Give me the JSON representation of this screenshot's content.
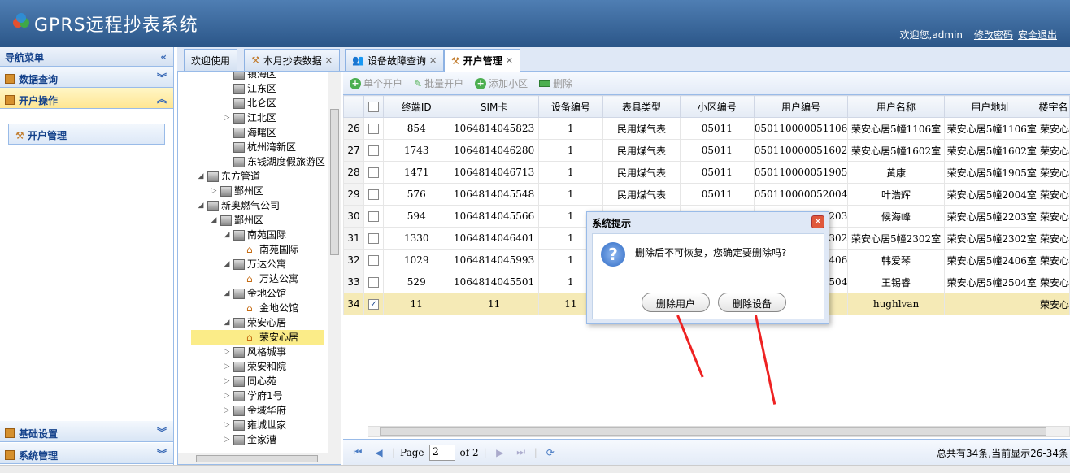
{
  "header": {
    "title": "GPRS远程抄表系统",
    "welcome": "欢迎您,admin",
    "change_password": "修改密码",
    "logout": "安全退出"
  },
  "nav": {
    "title": "导航菜单",
    "sections": [
      "数据查询",
      "开户操作",
      "基础设置",
      "系统管理"
    ],
    "active_item": "开户管理"
  },
  "tree": [
    {
      "label": "镇海区",
      "type": "building",
      "level": 2
    },
    {
      "label": "江东区",
      "type": "building",
      "level": 2
    },
    {
      "label": "北仑区",
      "type": "building",
      "level": 2
    },
    {
      "label": "江北区",
      "type": "building",
      "level": 2,
      "toggle": "▷"
    },
    {
      "label": "海曙区",
      "type": "building",
      "level": 2
    },
    {
      "label": "杭州湾新区",
      "type": "building",
      "level": 2
    },
    {
      "label": "东钱湖度假旅游区",
      "type": "building",
      "level": 2
    },
    {
      "label": "东方管道",
      "type": "building",
      "level": 0,
      "toggle": "◢"
    },
    {
      "label": "鄞州区",
      "type": "building",
      "level": 1,
      "toggle": "▷"
    },
    {
      "label": "新奥燃气公司",
      "type": "building",
      "level": 0,
      "toggle": "◢"
    },
    {
      "label": "鄞州区",
      "type": "building",
      "level": 1,
      "toggle": "◢"
    },
    {
      "label": "南苑国际",
      "type": "building",
      "level": 2,
      "toggle": "◢"
    },
    {
      "label": "南苑国际",
      "type": "house",
      "level": 3
    },
    {
      "label": "万达公寓",
      "type": "building",
      "level": 2,
      "toggle": "◢"
    },
    {
      "label": "万达公寓",
      "type": "house",
      "level": 3
    },
    {
      "label": "金地公馆",
      "type": "building",
      "level": 2,
      "toggle": "◢"
    },
    {
      "label": "金地公馆",
      "type": "house",
      "level": 3
    },
    {
      "label": "荣安心居",
      "type": "building",
      "level": 2,
      "toggle": "◢"
    },
    {
      "label": "荣安心居",
      "type": "house",
      "level": 3,
      "selected": true
    },
    {
      "label": "风格城事",
      "type": "building",
      "level": 2,
      "toggle": "▷"
    },
    {
      "label": "荣安和院",
      "type": "building",
      "level": 2,
      "toggle": "▷"
    },
    {
      "label": "同心苑",
      "type": "building",
      "level": 2,
      "toggle": "▷"
    },
    {
      "label": "学府1号",
      "type": "building",
      "level": 2,
      "toggle": "▷"
    },
    {
      "label": "金域华府",
      "type": "building",
      "level": 2,
      "toggle": "▷"
    },
    {
      "label": "雍城世家",
      "type": "building",
      "level": 2,
      "toggle": "▷"
    },
    {
      "label": "金家漕",
      "type": "building",
      "level": 2,
      "toggle": "▷"
    }
  ],
  "tabs": [
    {
      "label": "欢迎使用",
      "icon": "",
      "closable": false
    },
    {
      "label": "本月抄表数据",
      "icon": "hammer",
      "closable": true
    },
    {
      "label": "设备故障查询",
      "icon": "people",
      "closable": true
    },
    {
      "label": "开户管理",
      "icon": "hammer",
      "closable": true,
      "active": true
    }
  ],
  "toolbar": {
    "single": "单个开户",
    "batch": "批量开户",
    "add_area": "添加小区",
    "delete": "删除"
  },
  "grid": {
    "columns": [
      "终端ID",
      "SIM卡",
      "设备编号",
      "表具类型",
      "小区编号",
      "用户编号",
      "用户名称",
      "用户地址",
      "楼宇名"
    ],
    "rows": [
      {
        "n": "26",
        "checked": false,
        "c": [
          "854",
          "1064814045823",
          "1",
          "民用煤气表",
          "05011",
          "050110000051106",
          "荣安心居5幢1106室",
          "荣安心居5幢1106室",
          "荣安心"
        ]
      },
      {
        "n": "27",
        "checked": false,
        "c": [
          "1743",
          "1064814046280",
          "1",
          "民用煤气表",
          "05011",
          "050110000051602",
          "荣安心居5幢1602室",
          "荣安心居5幢1602室",
          "荣安心"
        ]
      },
      {
        "n": "28",
        "checked": false,
        "c": [
          "1471",
          "1064814046713",
          "1",
          "民用煤气表",
          "05011",
          "050110000051905",
          "黄康",
          "荣安心居5幢1905室",
          "荣安心"
        ]
      },
      {
        "n": "29",
        "checked": false,
        "c": [
          "576",
          "1064814045548",
          "1",
          "民用煤气表",
          "05011",
          "050110000052004",
          "叶浩辉",
          "荣安心居5幢2004室",
          "荣安心"
        ]
      },
      {
        "n": "30",
        "checked": false,
        "c": [
          "594",
          "1064814045566",
          "1",
          "",
          "",
          "050110000052203",
          "候海峰",
          "荣安心居5幢2203室",
          "荣安心"
        ]
      },
      {
        "n": "31",
        "checked": false,
        "c": [
          "1330",
          "1064814046401",
          "1",
          "",
          "",
          "050110000052302",
          "荣安心居5幢2302室",
          "荣安心居5幢2302室",
          "荣安心"
        ]
      },
      {
        "n": "32",
        "checked": false,
        "c": [
          "1029",
          "1064814045993",
          "1",
          "",
          "",
          "050110000052406",
          "韩爱琴",
          "荣安心居5幢2406室",
          "荣安心"
        ]
      },
      {
        "n": "33",
        "checked": false,
        "c": [
          "529",
          "1064814045501",
          "1",
          "",
          "",
          "050110000052504",
          "王锡睿",
          "荣安心居5幢2504室",
          "荣安心"
        ]
      },
      {
        "n": "34",
        "checked": true,
        "c": [
          "11",
          "11",
          "11",
          "",
          "",
          "",
          "hughlvan",
          "",
          "荣安心"
        ]
      }
    ]
  },
  "pager": {
    "page_label": "Page",
    "page_value": "2",
    "of_label": "of 2",
    "summary": "总共有34条,当前显示26-34条"
  },
  "dialog": {
    "title": "系统提示",
    "message": "删除后不可恢复，您确定要删除吗?",
    "btn_user": "删除用户",
    "btn_device": "删除设备"
  }
}
